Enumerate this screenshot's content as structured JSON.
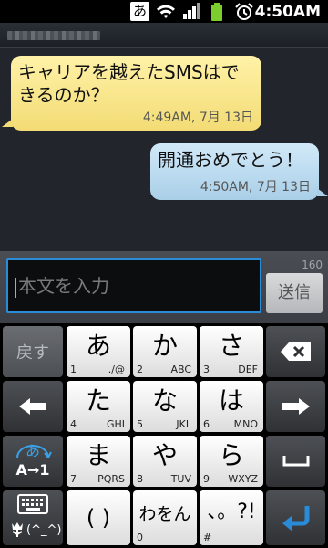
{
  "status_bar": {
    "ime_indicator": "あ",
    "time": "4:50AM",
    "icons": [
      "wifi-icon",
      "signal-icon",
      "battery-icon",
      "alarm-icon"
    ]
  },
  "conversation": {
    "messages": [
      {
        "direction": "incoming",
        "text": "キャリアを越えたSMSはできるのか？",
        "time": "4:49AM, 7月 13日"
      },
      {
        "direction": "outgoing",
        "text": "開通おめでとう！",
        "time": "4:50AM, 7月 13日"
      }
    ]
  },
  "compose": {
    "placeholder": "本文を入力",
    "char_count": "160",
    "send_label": "送信"
  },
  "keyboard": {
    "back_label": "戻す",
    "mode_label_top": "あ",
    "mode_label_bottom": "A→1",
    "emoticon_label": "(^_^)",
    "keys": [
      {
        "main": "あ",
        "num": "1",
        "sub": "./@"
      },
      {
        "main": "か",
        "num": "2",
        "sub": "ABC"
      },
      {
        "main": "さ",
        "num": "3",
        "sub": "DEF"
      },
      {
        "main": "た",
        "num": "4",
        "sub": "GHI"
      },
      {
        "main": "な",
        "num": "5",
        "sub": "JKL"
      },
      {
        "main": "は",
        "num": "6",
        "sub": "MNO"
      },
      {
        "main": "ま",
        "num": "7",
        "sub": "PQRS"
      },
      {
        "main": "や",
        "num": "8",
        "sub": "TUV"
      },
      {
        "main": "ら",
        "num": "9",
        "sub": "WXYZ"
      },
      {
        "main": "( )",
        "num": "",
        "sub": ""
      },
      {
        "main": "わをん",
        "num": "0",
        "sub": ""
      },
      {
        "main": "、。?!",
        "num": "#",
        "sub": ""
      }
    ],
    "colors": {
      "white_key": "#ffffff",
      "dark_key": "#3a3d41",
      "accent": "#2a8bd8"
    }
  }
}
